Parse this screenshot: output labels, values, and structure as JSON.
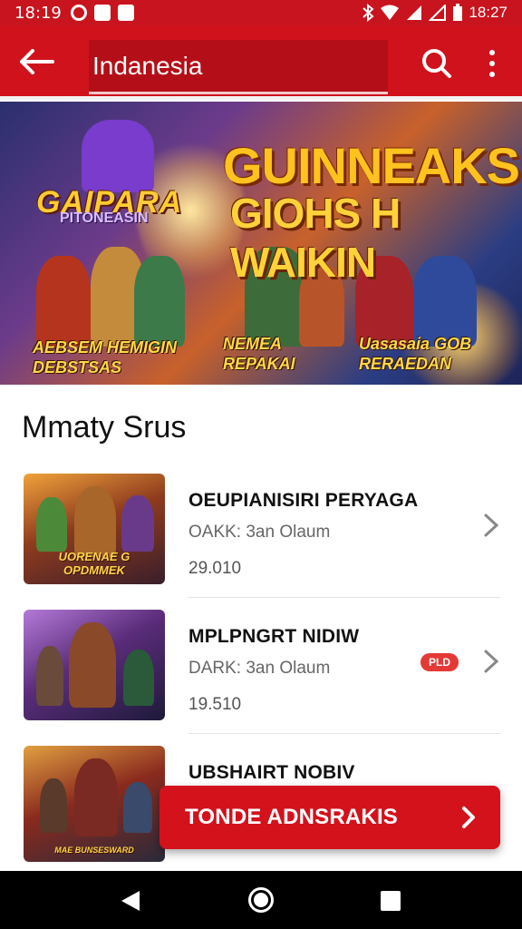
{
  "status_bar": {
    "time": "18:19",
    "clock_right": "18:27",
    "icons": [
      "bluetooth-icon",
      "wifi-icon",
      "signal-icon",
      "battery-icon"
    ]
  },
  "app_bar": {
    "search_value": "Indanesia",
    "back_icon": "arrow-left-icon",
    "search_icon": "search-icon",
    "more_icon": "more-vert-icon"
  },
  "banner": {
    "left_title": "GAIPARA",
    "left_subtitle": "PITONEASIN",
    "headline_line1": "GUINNEAKSI",
    "headline_line2": "GIOHS H WAIKIN",
    "caption_left_line1": "AEBSEM HEMIGIN",
    "caption_left_line2": "DEBSTSAS",
    "caption_center_line1": "NEMEA",
    "caption_center_line2": "REPAKAI",
    "caption_right_line1": "Uasasaia GOB",
    "caption_right_line2": "RERAEDAN"
  },
  "section": {
    "title": "Mmaty Srus"
  },
  "items": [
    {
      "title": "OEUPIANISIRI PERYAGA",
      "subtitle": "OAKK: 3an Olaum",
      "price": "29.010",
      "thumb_label": "UORENAE G OPDMMEK",
      "badge": ""
    },
    {
      "title": "MPLPNGRT NIDIW",
      "subtitle": "DARK: 3an Olaum",
      "price": "19.510",
      "thumb_label": "",
      "badge": "PLD"
    },
    {
      "title": "UBSHAIRT NOBIV",
      "subtitle": "",
      "price": "",
      "thumb_label": "MAE BUNSESWARD",
      "badge": ""
    }
  ],
  "cta": {
    "label": "TONDE ADNSRAKIS",
    "icon": "chevron-right-icon"
  },
  "nav_bar": {
    "back": "nav-back-icon",
    "home": "nav-home-icon",
    "recents": "nav-recents-icon"
  },
  "colors": {
    "primary": "#d0121c",
    "primary_dark": "#b40f18",
    "badge": "#e53935"
  }
}
